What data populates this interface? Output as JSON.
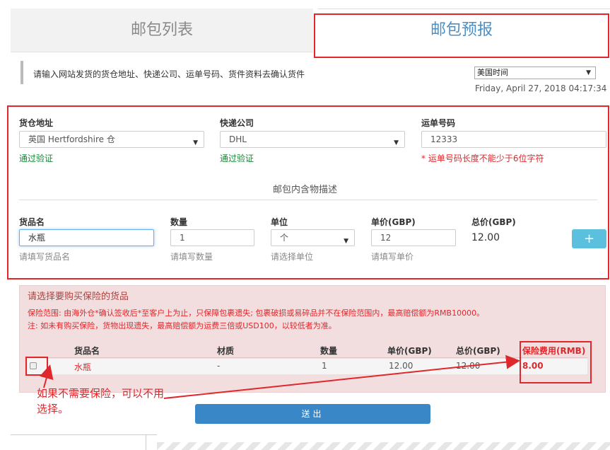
{
  "tabs": [
    {
      "label": "邮包列表"
    },
    {
      "label": "邮包预报"
    }
  ],
  "notice": "请输入网站发货的货仓地址、快递公司、运单号码、货件资料去确认货件",
  "timezone": {
    "selected": "美国时间"
  },
  "datetime": "Friday, April 27, 2018  04:17:34",
  "form": {
    "warehouse": {
      "label": "货仓地址",
      "value": "英国 Hertfordshire 仓",
      "status": "通过验证"
    },
    "courier": {
      "label": "快递公司",
      "value": "DHL",
      "status": "通过验证"
    },
    "tracking": {
      "label": "运单号码",
      "value": "12333",
      "error": "* 运单号码长度不能少于6位字符"
    }
  },
  "contents": {
    "title": "邮包内含物描述",
    "name": {
      "label": "货品名",
      "value": "水瓶",
      "help": "请填写货品名"
    },
    "qty": {
      "label": "数量",
      "value": "1",
      "help": "请填写数量"
    },
    "unit": {
      "label": "单位",
      "value": "个",
      "help": "请选择单位"
    },
    "price": {
      "label": "单价(GBP)",
      "value": "12",
      "help": "请填写单价"
    },
    "total": {
      "label": "总价(GBP)",
      "value": "12.00"
    },
    "add_label": "+"
  },
  "insurance": {
    "title": "请选择要购买保险的货品",
    "note1": "保险范围: 由海外仓*确认签收后*至客户上为止，只保障包裹遗失; 包裹破损或易碎品并不在保险范围内，最高赔偿额为RMB10000。",
    "note2": "注: 如未有购买保险，货物出现遗失，最高赔偿额为运费三倍或USD100，以较低者为准。",
    "headers": {
      "name": "货品名",
      "material": "材质",
      "qty": "数量",
      "price": "单价(GBP)",
      "total": "总价(GBP)",
      "fee": "保险费用(RMB)"
    },
    "row": {
      "name": "水瓶",
      "material": "-",
      "qty": "1",
      "price": "12.00",
      "total": "12.00",
      "fee": "8.00"
    }
  },
  "annotation": "如果不需要保险，可以不用选择。",
  "submit_label": "送出",
  "colors": {
    "highlight": "#e0272c",
    "primary": "#3a87c8",
    "info": "#5bc0de",
    "success": "#118833"
  }
}
